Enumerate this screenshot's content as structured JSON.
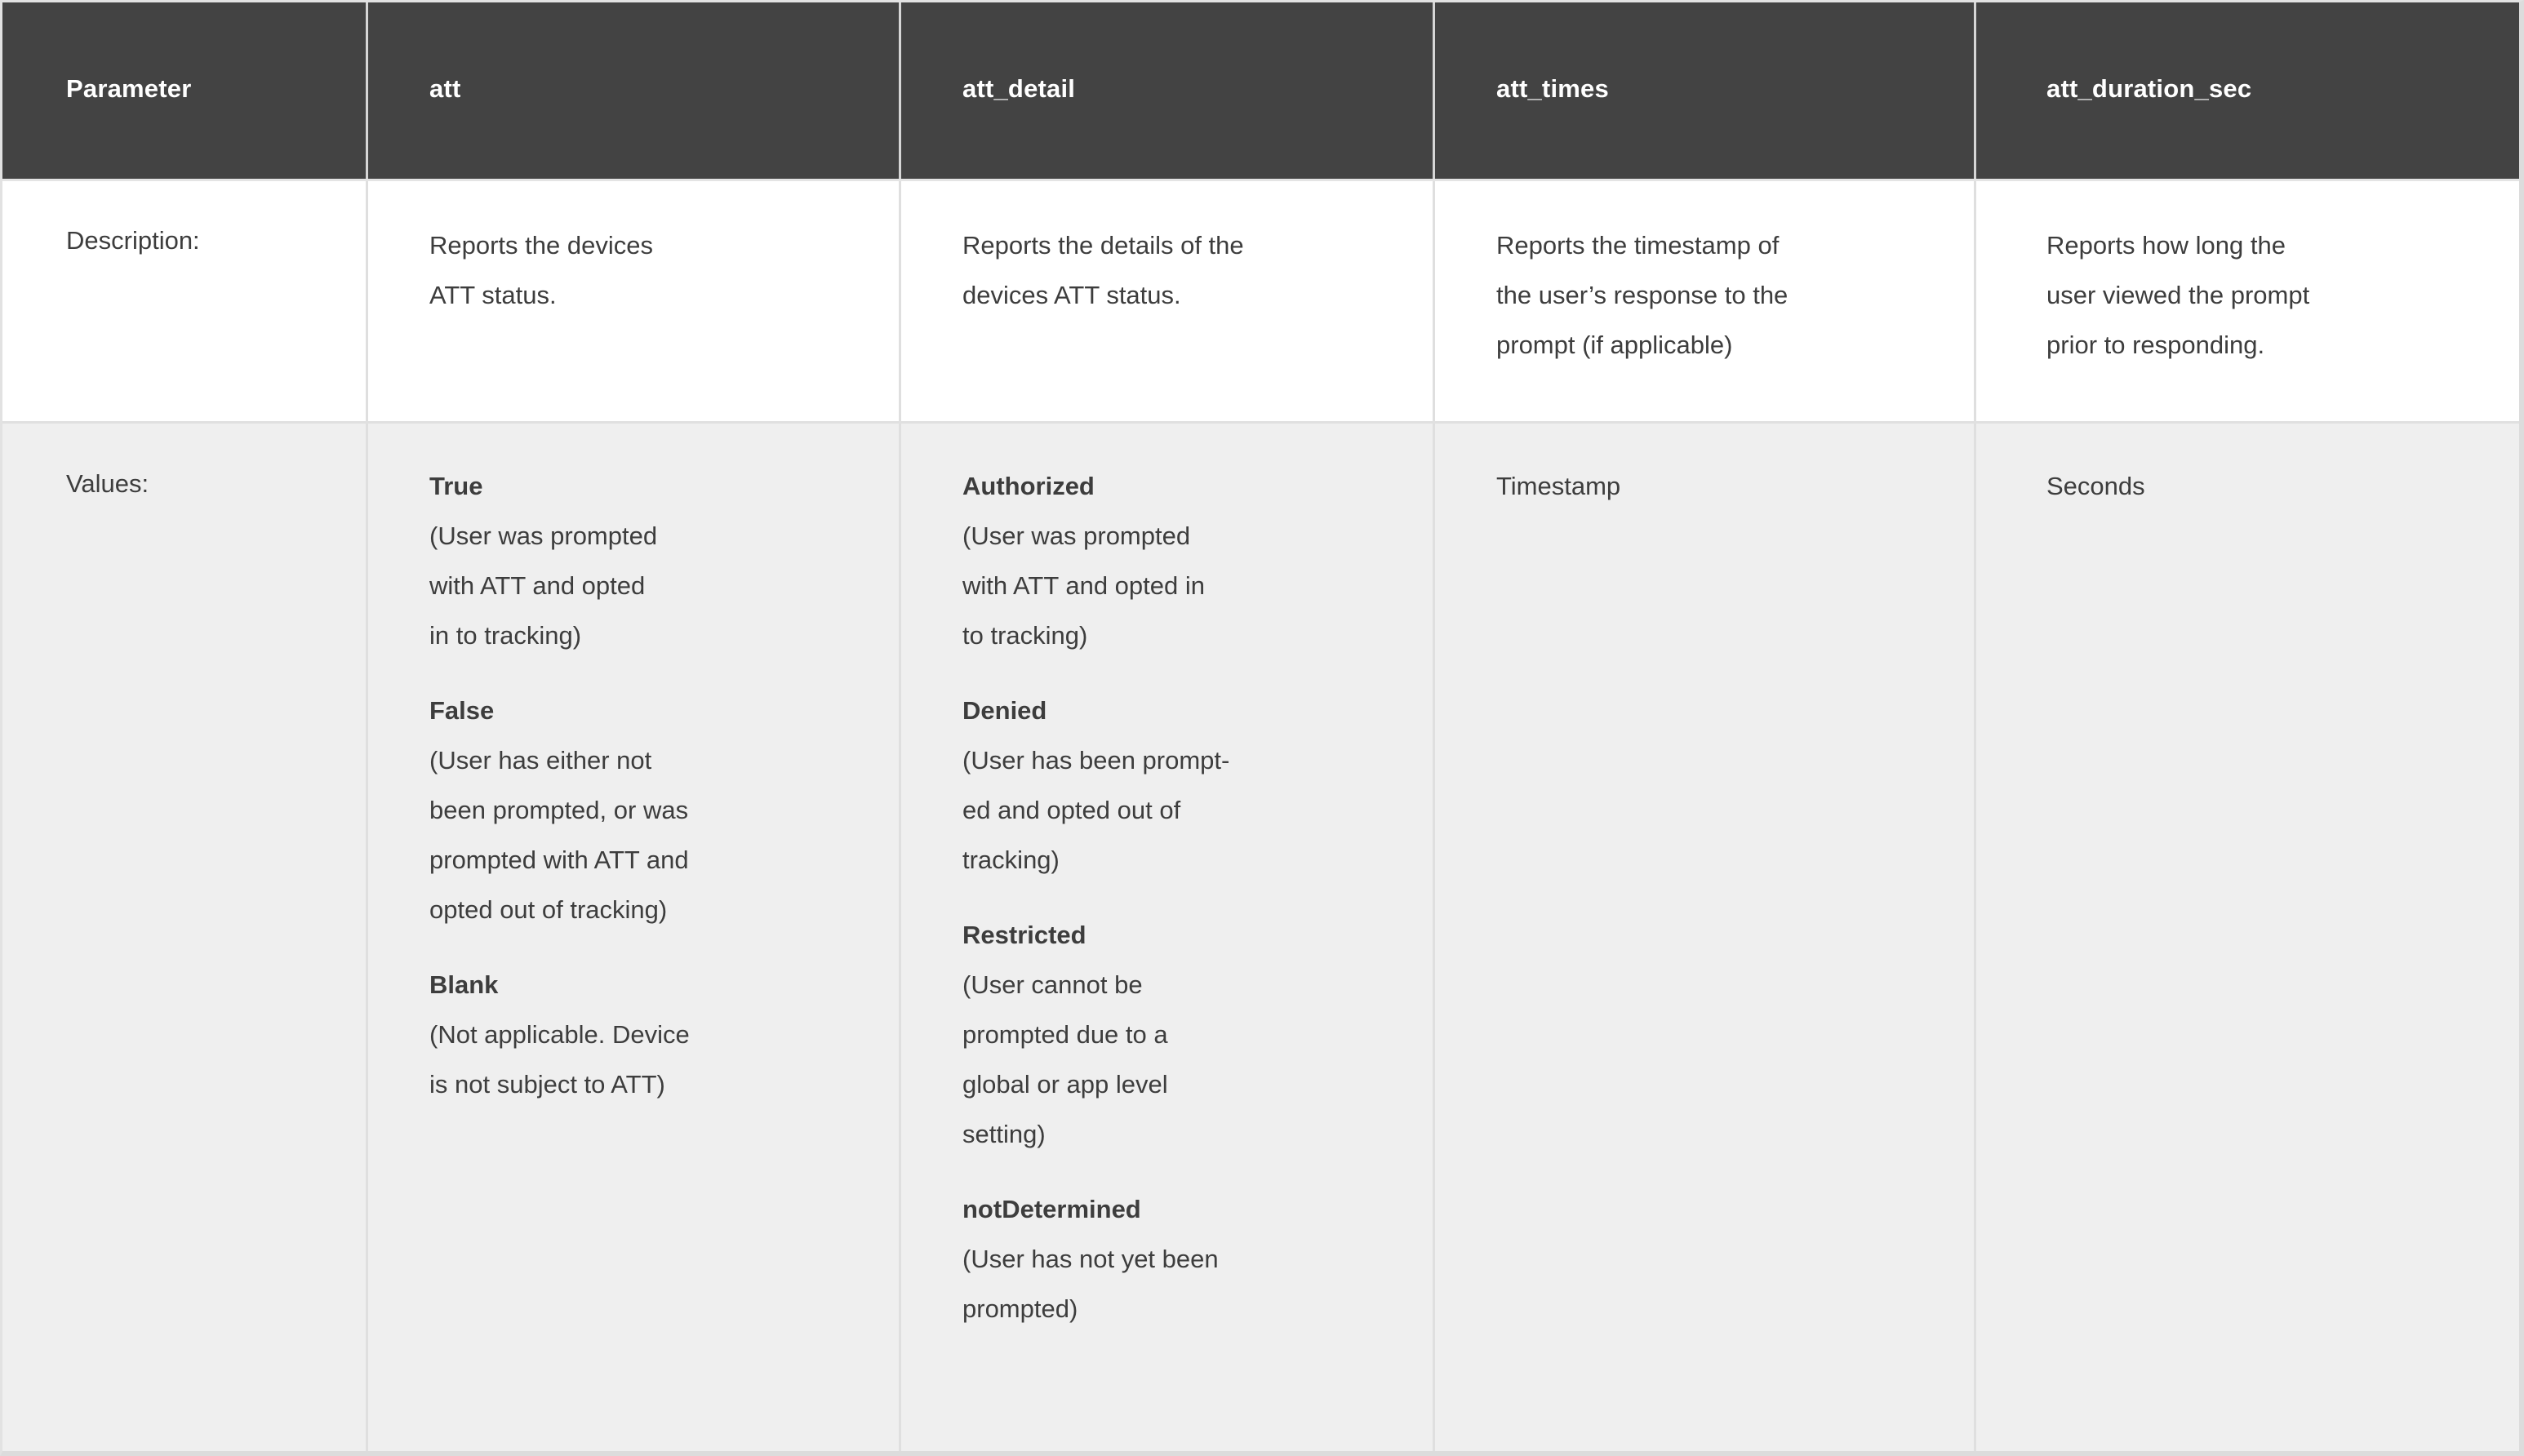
{
  "table": {
    "columns": [
      {
        "key": "parameter",
        "header": "Parameter"
      },
      {
        "key": "att",
        "header": "att"
      },
      {
        "key": "att_detail",
        "header": "att_detail"
      },
      {
        "key": "att_times",
        "header": "att_times"
      },
      {
        "key": "att_duration_sec",
        "header": "att_duration_sec"
      }
    ],
    "rows": {
      "description": {
        "label": "Description:",
        "cells": [
          "Reports the devices\nATT status.",
          "Reports the details of the\ndevices ATT status.",
          "Reports the timestamp of\nthe user’s response to the\nprompt (if applicable)",
          "Reports how long the\nuser viewed the prompt\nprior to responding."
        ]
      },
      "values": {
        "label": "Values:",
        "cells": [
          {
            "type": "definition-list",
            "items": [
              {
                "term": "True",
                "definition": "(User was prompted\n with ATT and opted\nin to tracking)"
              },
              {
                "term": "False",
                "definition": "(User has either not\nbeen prompted, or was\nprompted with ATT and\nopted out of tracking)"
              },
              {
                "term": "Blank",
                "definition": "(Not applicable. Device\nis not subject to ATT)"
              }
            ]
          },
          {
            "type": "definition-list",
            "items": [
              {
                "term": "Authorized",
                "definition": "(User was prompted\nwith ATT and opted in\nto tracking)"
              },
              {
                "term": "Denied",
                "definition": "(User has been prompt-\ned and opted out of\ntracking)"
              },
              {
                "term": "Restricted",
                "definition": "(User cannot be\nprompted due to a\nglobal or app level\nsetting)"
              },
              {
                "term": "notDetermined",
                "definition": "(User has not yet been\nprompted)"
              }
            ]
          },
          {
            "type": "text",
            "text": "Timestamp"
          },
          {
            "type": "text",
            "text": "Seconds"
          }
        ]
      }
    }
  },
  "colors": {
    "header_background": "#434343",
    "header_text": "#ffffff",
    "description_background": "#ffffff",
    "values_background": "#efefef",
    "body_text": "#3d3d3d",
    "divider": "#dfdfdf"
  }
}
